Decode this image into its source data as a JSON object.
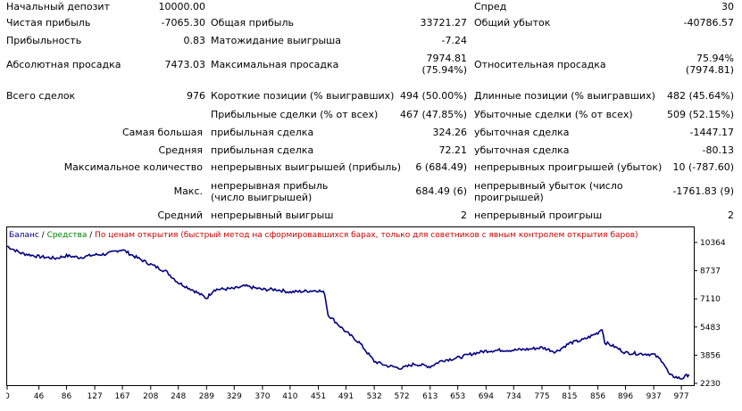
{
  "stats": {
    "initial_deposit": {
      "label": "Начальный депозит",
      "value": "10000.00"
    },
    "spread": {
      "label": "Спред",
      "value": "30"
    },
    "net_profit": {
      "label": "Чистая прибыль",
      "value": "-7065.30"
    },
    "gross_profit": {
      "label": "Общая прибыль",
      "value": "33721.27"
    },
    "gross_loss": {
      "label": "Общий убыток",
      "value": "-40786.57"
    },
    "profit_factor": {
      "label": "Прибыльность",
      "value": "0.83"
    },
    "expected_payoff": {
      "label": "Матожидание выигрыша",
      "value": "-7.24"
    },
    "abs_drawdown": {
      "label": "Абсолютная просадка",
      "value": "7473.03"
    },
    "max_drawdown": {
      "label": "Максимальная просадка",
      "value": "7974.81",
      "value2": "(75.94%)"
    },
    "rel_drawdown": {
      "label": "Относительная просадка",
      "value": "75.94%",
      "value2": "(7974.81)"
    },
    "total_trades": {
      "label": "Всего сделок",
      "value": "976"
    },
    "short_pos": {
      "label": "Короткие позиции (% выигравших)",
      "value": "494 (50.00%)"
    },
    "long_pos": {
      "label": "Длинные позиции (% выигравших)",
      "value": "482 (45.64%)"
    },
    "profit_trades": {
      "label": "Прибыльные сделки (% от всех)",
      "value": "467 (47.85%)"
    },
    "loss_trades": {
      "label": "Убыточные сделки (% от всех)",
      "value": "509 (52.15%)"
    },
    "largest": {
      "label": "Самая большая",
      "p_label": "прибыльная сделка",
      "p_value": "324.26",
      "l_label": "убыточная сделка",
      "l_value": "-1447.17"
    },
    "average": {
      "label": "Средняя",
      "p_label": "прибыльная сделка",
      "p_value": "72.21",
      "l_label": "убыточная сделка",
      "l_value": "-80.13"
    },
    "max_consec": {
      "label": "Максимальное количество",
      "p_label": "непрерывных выигрышей (прибыль)",
      "p_value": "6 (684.49)",
      "l_label": "непрерывных проигрышей (убыток)",
      "l_value": "10 (-787.60)"
    },
    "max_consec2": {
      "label": "Макс.",
      "p_label": "непрерывная прибыль (число выигрышей)",
      "p_value": "684.49 (6)",
      "l_label": "непрерывный убыток (число проигрышей)",
      "l_value": "-1761.83 (9)"
    },
    "avg_consec": {
      "label": "Средний",
      "p_label": "непрерывный выигрыш",
      "p_value": "2",
      "l_label": "непрерывный проигрыш",
      "l_value": "2"
    }
  },
  "chart_data": {
    "type": "line",
    "legend": {
      "balance": "Баланс",
      "sep1": " / ",
      "equity": "Средства",
      "sep2": " / ",
      "mode": "По ценам открытия (быстрый метод на сформировавшихся барах, только для советников с явным контролем открытия баров)"
    },
    "colors": {
      "balance": "#000080",
      "equity": "#008000",
      "mode": "#cc0000",
      "grid": "#000000"
    },
    "x_ticks": [
      0,
      46,
      86,
      127,
      167,
      208,
      248,
      289,
      329,
      370,
      410,
      451,
      491,
      532,
      572,
      613,
      653,
      694,
      734,
      775,
      815,
      856,
      896,
      937,
      977
    ],
    "y_ticks": [
      10364,
      8737,
      7110,
      5483,
      3856,
      2230
    ],
    "xlim": [
      0,
      995
    ],
    "ylim": [
      2230,
      10364
    ],
    "series": [
      {
        "name": "Баланс",
        "x": [
          0,
          20,
          46,
          70,
          86,
          105,
          127,
          145,
          160,
          167,
          185,
          208,
          230,
          248,
          270,
          289,
          300,
          329,
          345,
          370,
          390,
          410,
          430,
          451,
          460,
          465,
          491,
          510,
          532,
          550,
          572,
          590,
          613,
          630,
          653,
          675,
          694,
          715,
          734,
          755,
          775,
          795,
          815,
          835,
          856,
          862,
          866,
          880,
          896,
          915,
          937,
          950,
          960,
          977,
          988
        ],
        "y": [
          10150,
          9750,
          9550,
          9450,
          9600,
          9500,
          9650,
          9700,
          9900,
          9950,
          9550,
          9100,
          8700,
          8050,
          7600,
          7150,
          7650,
          7700,
          7850,
          7650,
          7650,
          7500,
          7550,
          7600,
          7450,
          6200,
          5200,
          4600,
          3500,
          3250,
          3100,
          3350,
          3200,
          3550,
          3700,
          3950,
          4100,
          4150,
          4150,
          4200,
          4300,
          4050,
          4550,
          4750,
          5150,
          5400,
          4600,
          4350,
          4000,
          3950,
          3900,
          3500,
          2700,
          2500,
          2750
        ]
      }
    ]
  }
}
